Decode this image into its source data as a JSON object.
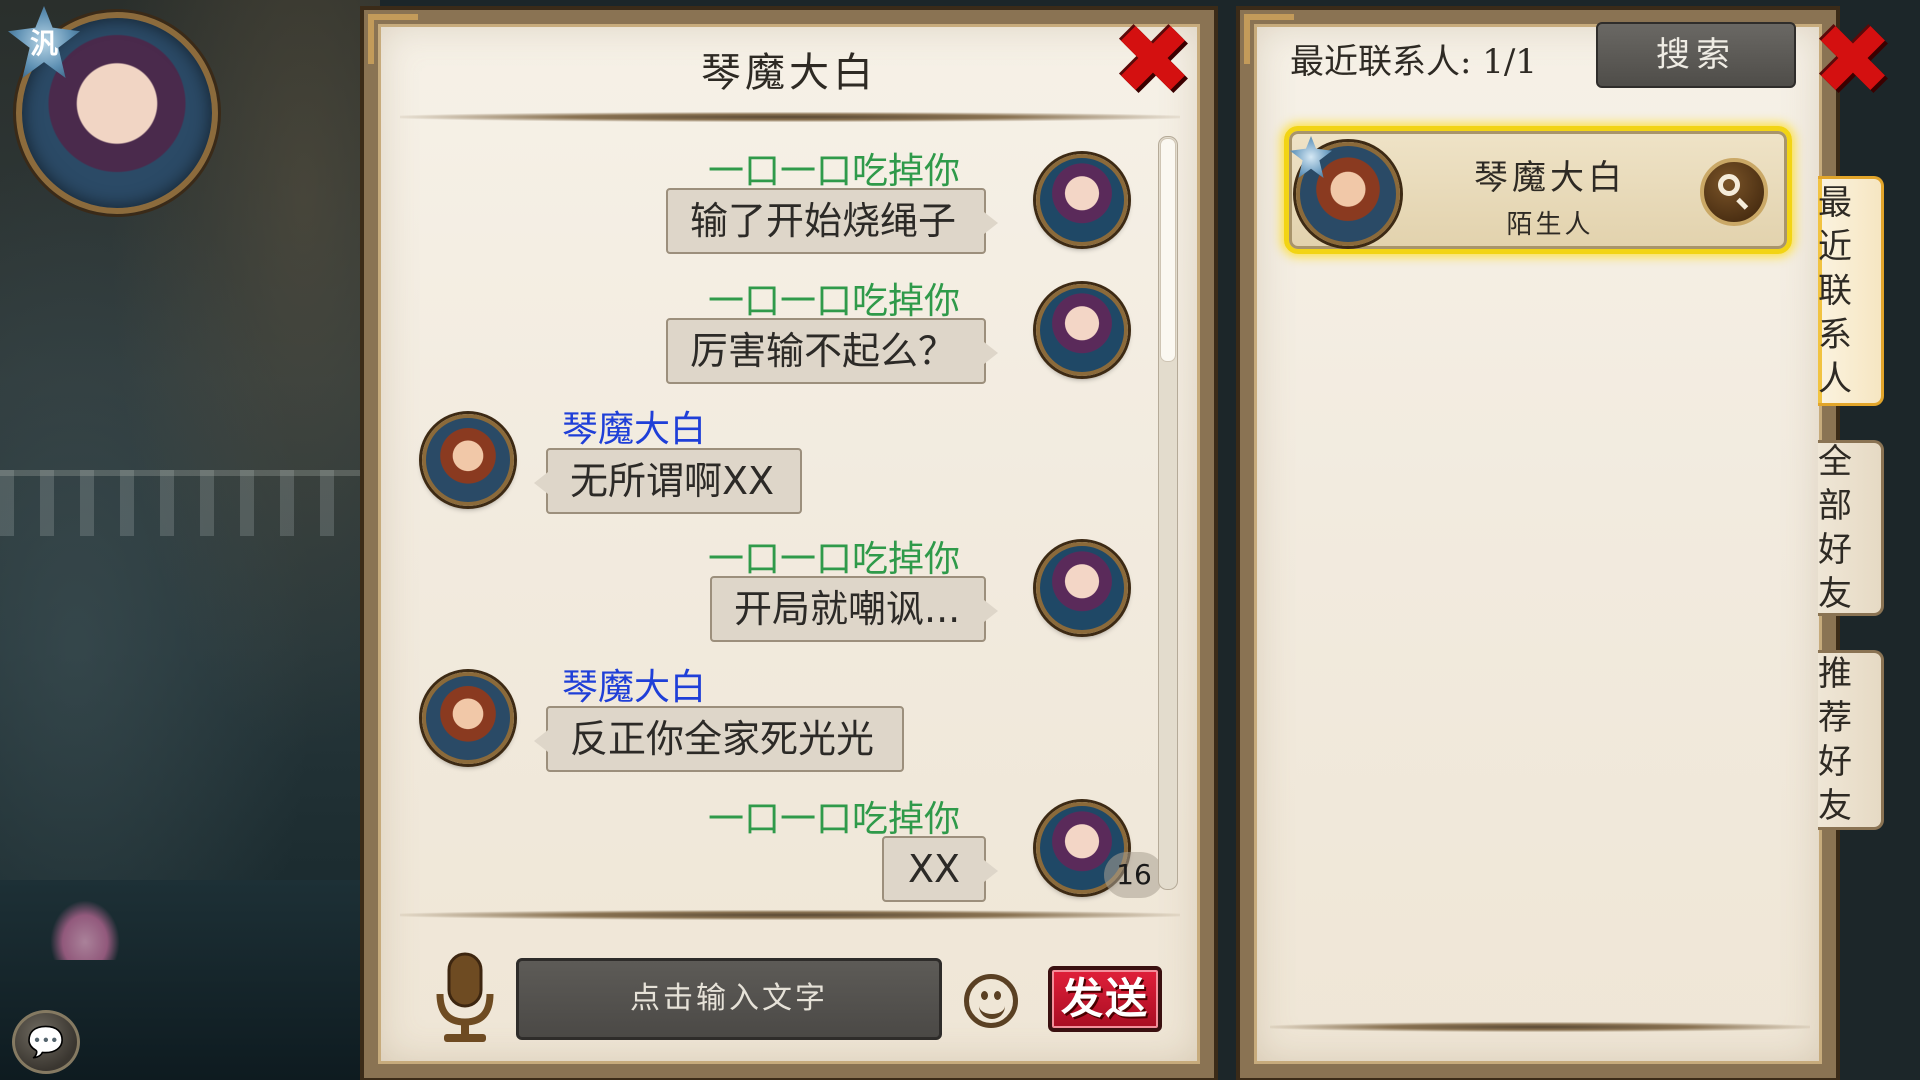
{
  "chat": {
    "title": "琴魔大白",
    "messages": [
      {
        "sender": "一口一口吃掉你",
        "text": "输了开始烧绳子",
        "side": "me"
      },
      {
        "sender": "一口一口吃掉你",
        "text": "厉害输不起么？",
        "side": "me"
      },
      {
        "sender": "琴魔大白",
        "text": "无所谓啊XX",
        "side": "them"
      },
      {
        "sender": "一口一口吃掉你",
        "text": "开局就嘲讽...",
        "side": "me"
      },
      {
        "sender": "琴魔大白",
        "text": "反正你全家死光光",
        "side": "them"
      },
      {
        "sender": "一口一口吃掉你",
        "text": "XX",
        "side": "me"
      }
    ],
    "unread_count": "16",
    "input_placeholder": "点击输入文字",
    "send_label": "发送"
  },
  "contacts": {
    "recent_label": "最近联系人: 1/1",
    "search_label": "搜索",
    "items": [
      {
        "name": "琴魔大白",
        "relation": "陌生人"
      }
    ],
    "tabs": [
      {
        "label": "最近联系人",
        "active": true
      },
      {
        "label": "全部好友",
        "active": false
      },
      {
        "label": "推荐好友",
        "active": false
      }
    ]
  },
  "player": {
    "badge_text": "汎"
  },
  "icons": {
    "mic": "microphone-icon",
    "emoji": "emoji-icon",
    "close": "close-icon",
    "view": "magnifier-icon",
    "chat_toggle": "chat-bubble-icon"
  },
  "colors": {
    "my_name": "#2f9a4a",
    "their_name": "#1f3fd8",
    "send_button": "#d41a30",
    "highlight": "#f2d414"
  }
}
